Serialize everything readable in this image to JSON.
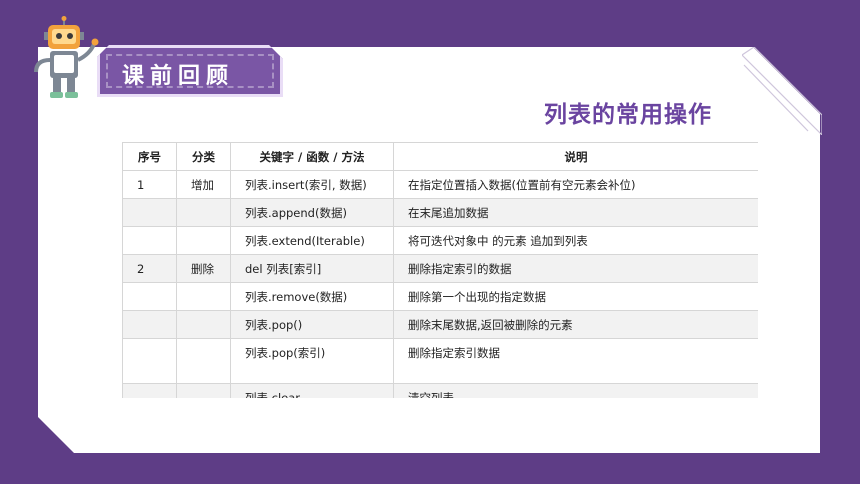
{
  "banner": {
    "text": "课前回顾"
  },
  "title": "列表的常用操作",
  "table": {
    "headers": [
      "序号",
      "分类",
      "关键字 / 函数 / 方法",
      "说明"
    ],
    "rows": [
      [
        "1",
        "增加",
        "列表.insert(索引, 数据)",
        "在指定位置插入数据(位置前有空元素会补位)"
      ],
      [
        "",
        "",
        "列表.append(数据)",
        "在末尾追加数据"
      ],
      [
        "",
        "",
        "列表.extend(Iterable)",
        "将可迭代对象中 的元素 追加到列表"
      ],
      [
        "2",
        "删除",
        "del 列表[索引]",
        "删除指定索引的数据"
      ],
      [
        "",
        "",
        "列表.remove(数据)",
        "删除第一个出现的指定数据"
      ],
      [
        "",
        "",
        "列表.pop()",
        "删除末尾数据,返回被删除的元素"
      ],
      [
        "",
        "",
        "列表.pop(索引)",
        "删除指定索引数据"
      ],
      [
        "",
        "",
        "列表.clear",
        "清空列表"
      ]
    ]
  },
  "colors": {
    "background": "#5e3d86",
    "accent": "#6a44a0",
    "card": "#ffffff"
  },
  "icons": {
    "mascot": "robot-icon"
  }
}
